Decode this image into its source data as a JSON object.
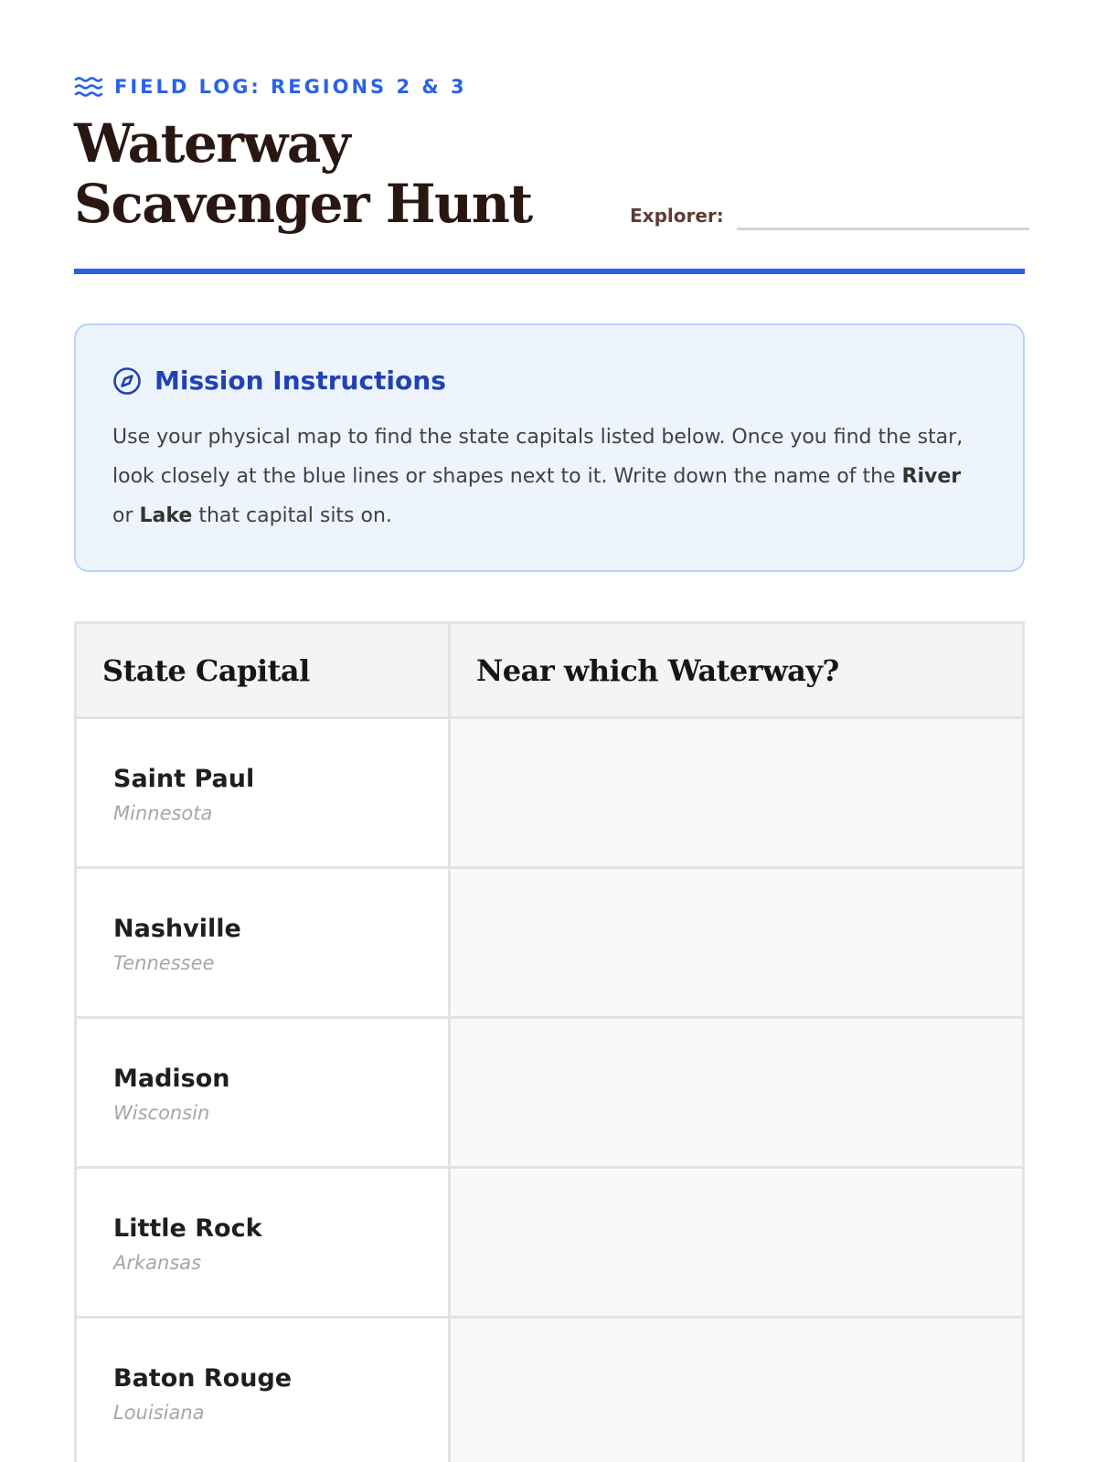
{
  "header": {
    "eyebrow": "FIELD LOG: REGIONS 2 & 3",
    "eyebrow_icon": "waves-icon",
    "title": "Waterway Scavenger Hunt",
    "explorer_label": "Explorer:",
    "explorer_value": ""
  },
  "mission": {
    "icon": "compass-icon",
    "heading": "Mission Instructions",
    "text_before": "Use your physical map to find the state capitals listed below. Once you find the star, look closely at the blue lines or shapes next to it. Write down the name of the ",
    "bold1": "River",
    "text_mid": " or ",
    "bold2": "Lake",
    "text_after": " that capital sits on."
  },
  "table": {
    "headers": [
      "State Capital",
      "Near which Waterway?"
    ],
    "rows": [
      {
        "city": "Saint Paul",
        "state": "Minnesota",
        "answer": ""
      },
      {
        "city": "Nashville",
        "state": "Tennessee",
        "answer": ""
      },
      {
        "city": "Madison",
        "state": "Wisconsin",
        "answer": ""
      },
      {
        "city": "Little Rock",
        "state": "Arkansas",
        "answer": ""
      },
      {
        "city": "Baton Rouge",
        "state": "Louisiana",
        "answer": ""
      }
    ]
  },
  "colors": {
    "accent": "#2a5fe3",
    "heading_blue": "#2142b6",
    "title": "#2a1712",
    "panel_bg": "#edf4fe"
  }
}
